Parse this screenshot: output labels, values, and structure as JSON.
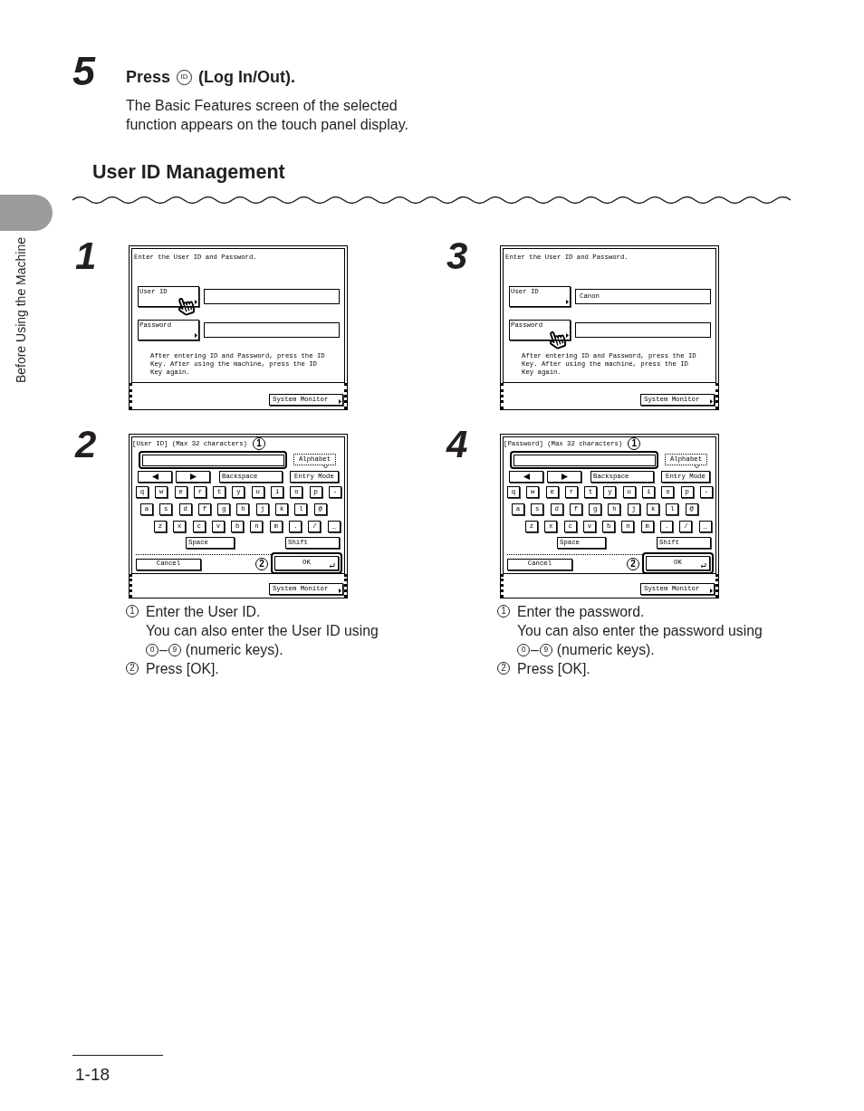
{
  "side_tab": {
    "label": "Before Using the Machine"
  },
  "intro_step": {
    "number": "5",
    "press": "Press",
    "key": "ID",
    "action": "(Log In/Out).",
    "description": "The Basic Features screen of the selected function appears on the touch panel display."
  },
  "section": {
    "title": "User ID Management"
  },
  "steps": [
    {
      "number": "1",
      "screen": {
        "kind": "login",
        "prompt": "Enter the User ID and Password.",
        "fields": [
          {
            "button": "User ID",
            "pointer": true
          },
          {
            "button": "Password",
            "pointer": false
          }
        ],
        "message": "After entering ID and Password, press the ID Key. After using the machine, press the ID Key again.",
        "footer_button": "System Monitor"
      }
    },
    {
      "number": "2",
      "screen": {
        "kind": "keyboard",
        "title": "[User ID] (Max 32 characters)",
        "entry_callout": "1",
        "mode": "Alphabet",
        "backspace": "Backspace",
        "entry_mode": "Entry Mode",
        "key_rows": [
          [
            "q",
            "w",
            "e",
            "r",
            "t",
            "y",
            "u",
            "i",
            "o",
            "p",
            "-"
          ],
          [
            "a",
            "s",
            "d",
            "f",
            "g",
            "h",
            "j",
            "k",
            "l",
            "@"
          ],
          [
            "z",
            "x",
            "c",
            "v",
            "b",
            "n",
            "m",
            ".",
            "/",
            "_"
          ]
        ],
        "space": "Space",
        "shift": "Shift",
        "cancel": "Cancel",
        "ok_callout": "2",
        "ok": "OK",
        "footer_button": "System Monitor"
      },
      "notes": [
        {
          "marker": "1",
          "text": "Enter the User ID.",
          "detail": "You can also enter the User ID using",
          "key_from": "0",
          "key_dash": "–",
          "key_to": "9",
          "key_note": "(numeric keys)."
        },
        {
          "marker": "2",
          "text": "Press [OK]."
        }
      ]
    },
    {
      "number": "3",
      "screen": {
        "kind": "login",
        "prompt": "Enter the User ID and Password.",
        "fields": [
          {
            "button": "User ID",
            "value": "Canon",
            "pointer": false
          },
          {
            "button": "Password",
            "pointer": true
          }
        ],
        "message": "After entering ID and Password, press the ID Key. After using the machine, press the ID Key again.",
        "footer_button": "System Monitor"
      }
    },
    {
      "number": "4",
      "screen": {
        "kind": "keyboard",
        "title": "[Password] (Max 32 characters)",
        "entry_callout": "1",
        "mode": "Alphabet",
        "backspace": "Backspace",
        "entry_mode": "Entry Mode",
        "key_rows": [
          [
            "q",
            "w",
            "e",
            "r",
            "t",
            "y",
            "u",
            "i",
            "o",
            "p",
            "-"
          ],
          [
            "a",
            "s",
            "d",
            "f",
            "g",
            "h",
            "j",
            "k",
            "l",
            "@"
          ],
          [
            "z",
            "x",
            "c",
            "v",
            "b",
            "n",
            "m",
            ".",
            "/",
            "_"
          ]
        ],
        "space": "Space",
        "shift": "Shift",
        "cancel": "Cancel",
        "ok_callout": "2",
        "ok": "OK",
        "footer_button": "System Monitor"
      },
      "notes": [
        {
          "marker": "1",
          "text": "Enter the password.",
          "detail": "You can also enter the password using",
          "key_from": "0",
          "key_dash": "–",
          "key_to": "9",
          "key_note": "(numeric keys)."
        },
        {
          "marker": "2",
          "text": "Press [OK]."
        }
      ]
    }
  ],
  "footer": {
    "page_number": "1-18"
  }
}
